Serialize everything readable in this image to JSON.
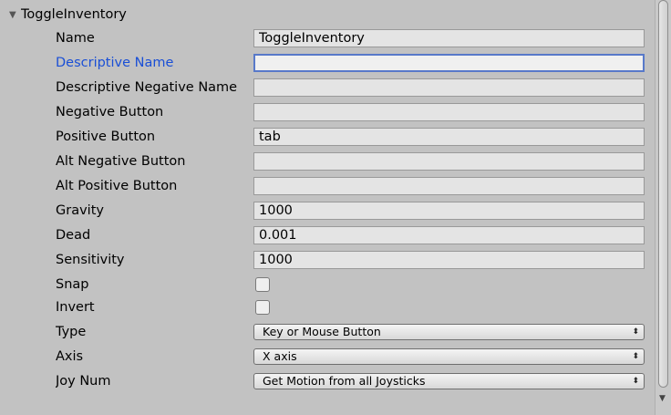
{
  "foldout": {
    "title": "ToggleInventory",
    "arrow": "▼"
  },
  "fields": {
    "name": {
      "label": "Name",
      "value": "ToggleInventory"
    },
    "descriptive_name": {
      "label": "Descriptive Name",
      "value": ""
    },
    "descriptive_negative_name": {
      "label": "Descriptive Negative Name",
      "value": ""
    },
    "negative_button": {
      "label": "Negative Button",
      "value": ""
    },
    "positive_button": {
      "label": "Positive Button",
      "value": "tab"
    },
    "alt_negative_button": {
      "label": "Alt Negative Button",
      "value": ""
    },
    "alt_positive_button": {
      "label": "Alt Positive Button",
      "value": ""
    },
    "gravity": {
      "label": "Gravity",
      "value": "1000"
    },
    "dead": {
      "label": "Dead",
      "value": "0.001"
    },
    "sensitivity": {
      "label": "Sensitivity",
      "value": "1000"
    },
    "snap": {
      "label": "Snap",
      "checked": false
    },
    "invert": {
      "label": "Invert",
      "checked": false
    },
    "type": {
      "label": "Type",
      "selected": "Key or Mouse Button"
    },
    "axis": {
      "label": "Axis",
      "selected": "X axis"
    },
    "joy_num": {
      "label": "Joy Num",
      "selected": "Get Motion from all Joysticks"
    }
  },
  "dropdown_caret": "⬍",
  "scroll_down_arrow": "▼",
  "colors": {
    "background": "#c2c2c2",
    "focus_label": "#1a4fd6",
    "focus_border": "#5879c9"
  }
}
